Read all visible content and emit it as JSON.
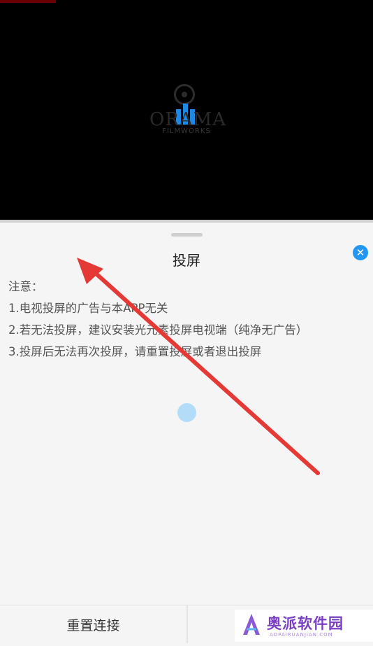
{
  "video": {
    "logo_word": "ORAMA",
    "logo_sub": "FILMWORKS"
  },
  "sheet": {
    "title": "投屏",
    "close_symbol": "✕",
    "notes": [
      "注意：",
      "1.电视投屏的广告与本APP无关",
      "2.若无法投屏，建议安装光元素投屏电视端（纯净无广告）",
      "3.投屏后无法再次投屏，请重置投屏或者退出投屏"
    ]
  },
  "bottom": {
    "reset_label": "重置连接"
  },
  "watermark": {
    "text": "奥派软件园",
    "sub": "AOPAIRUANJIAN.COM"
  },
  "colors": {
    "accent": "#2196f3",
    "arrow": "#e53935",
    "watermark": "#7a3fc4"
  },
  "icons": {
    "close": "close-icon",
    "loading": "loading-spinner-icon",
    "arrow": "red-arrow-annotation"
  }
}
